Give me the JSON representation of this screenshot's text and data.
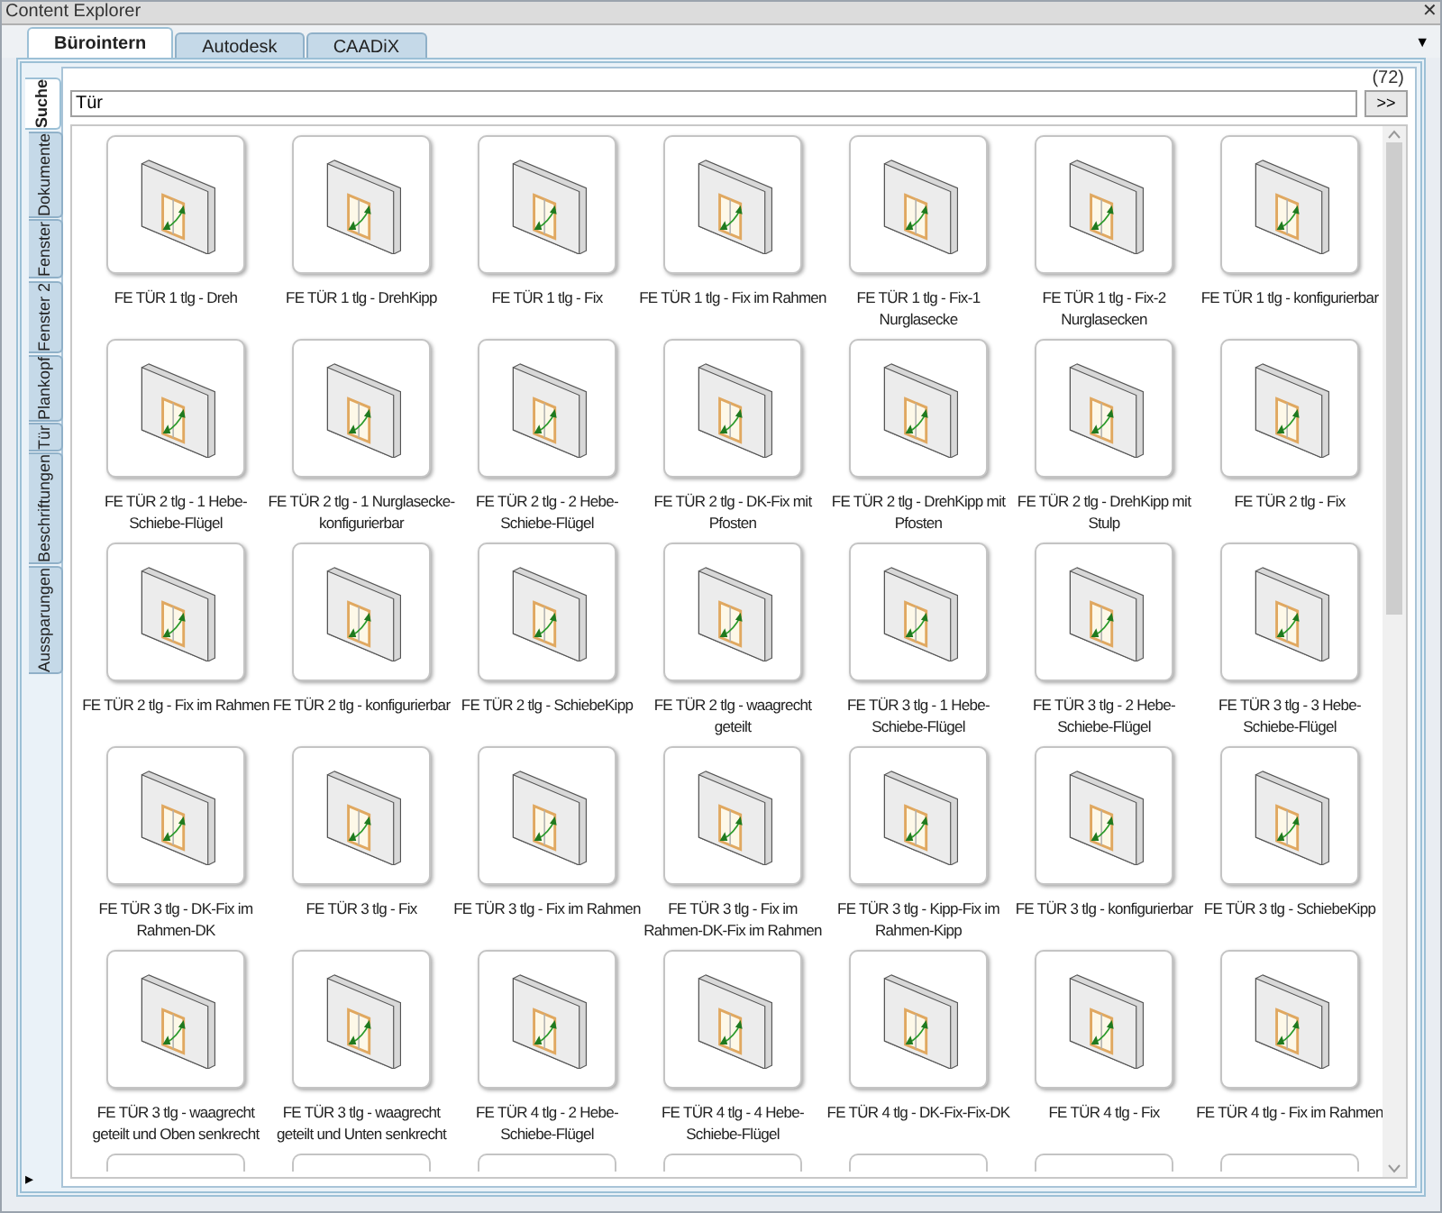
{
  "window": {
    "title": "Content Explorer",
    "close": "✕"
  },
  "tabs": [
    {
      "label": "Bürointern",
      "selected": true
    },
    {
      "label": "Autodesk",
      "selected": false
    },
    {
      "label": "CAADiX",
      "selected": false
    }
  ],
  "tab_menu": "▼",
  "side_tabs": [
    {
      "label": "Suche",
      "selected": true
    },
    {
      "label": "Dokumente",
      "selected": false
    },
    {
      "label": "Fenster",
      "selected": false
    },
    {
      "label": "Fenster 2",
      "selected": false
    },
    {
      "label": "Plankopf",
      "selected": false
    },
    {
      "label": "Tür",
      "selected": false
    },
    {
      "label": "Beschriftungen",
      "selected": false
    },
    {
      "label": "Aussparungen",
      "selected": false
    }
  ],
  "side_expand": "▸",
  "search": {
    "count": "(72)",
    "value": "Tür",
    "button": ">>"
  },
  "items": [
    {
      "kind": "tile",
      "label": "FE TÜR 1 tlg - Dreh"
    },
    {
      "kind": "tile",
      "label": "FE TÜR 1 tlg - DrehKipp"
    },
    {
      "kind": "tile",
      "label": "FE TÜR 1 tlg - Fix"
    },
    {
      "kind": "tile",
      "label": "FE TÜR 1 tlg - Fix im Rahmen"
    },
    {
      "kind": "tile",
      "label": "FE TÜR 1 tlg - Fix-1 Nurglasecke"
    },
    {
      "kind": "tile",
      "label": "FE TÜR 1 tlg - Fix-2 Nurglasecken"
    },
    {
      "kind": "tile",
      "label": "FE TÜR 1 tlg - konfigurierbar"
    },
    {
      "kind": "tile",
      "label": "FE TÜR 2 tlg - 1 Hebe-Schiebe-Flügel"
    },
    {
      "kind": "tile",
      "label": "FE TÜR 2 tlg - 1 Nurglasecke-konfigurierbar"
    },
    {
      "kind": "tile",
      "label": "FE TÜR 2 tlg - 2 Hebe-Schiebe-Flügel"
    },
    {
      "kind": "tile",
      "label": "FE TÜR 2 tlg - DK-Fix mit Pfosten"
    },
    {
      "kind": "tile",
      "label": "FE TÜR 2 tlg - DrehKipp mit Pfosten"
    },
    {
      "kind": "tile",
      "label": "FE TÜR 2 tlg - DrehKipp mit Stulp"
    },
    {
      "kind": "tile",
      "label": "FE TÜR 2 tlg - Fix"
    },
    {
      "kind": "tile",
      "label": "FE TÜR 2 tlg - Fix im Rahmen"
    },
    {
      "kind": "tile",
      "label": "FE TÜR 2 tlg - konfigurierbar"
    },
    {
      "kind": "tile",
      "label": "FE TÜR 2 tlg - SchiebeKipp"
    },
    {
      "kind": "tile",
      "label": "FE TÜR 2 tlg - waagrecht geteilt"
    },
    {
      "kind": "tile",
      "label": "FE TÜR 3 tlg - 1 Hebe-Schiebe-Flügel"
    },
    {
      "kind": "tile",
      "label": "FE TÜR 3 tlg - 2 Hebe-Schiebe-Flügel"
    },
    {
      "kind": "tile",
      "label": "FE TÜR 3 tlg - 3 Hebe-Schiebe-Flügel"
    },
    {
      "kind": "tile",
      "label": "FE TÜR 3 tlg - DK-Fix im Rahmen-DK"
    },
    {
      "kind": "tile",
      "label": "FE TÜR 3 tlg - Fix"
    },
    {
      "kind": "tile",
      "label": "FE TÜR 3 tlg - Fix im Rahmen"
    },
    {
      "kind": "tile",
      "label": "FE TÜR 3 tlg - Fix im Rahmen-DK-Fix im Rahmen"
    },
    {
      "kind": "tile",
      "label": "FE TÜR 3 tlg - Kipp-Fix im Rahmen-Kipp"
    },
    {
      "kind": "tile",
      "label": "FE TÜR 3 tlg - konfigurierbar"
    },
    {
      "kind": "tile",
      "label": "FE TÜR 3 tlg - SchiebeKipp"
    },
    {
      "kind": "tile",
      "label": "FE TÜR 3 tlg - waagrecht geteilt und Oben senkrecht"
    },
    {
      "kind": "tile",
      "label": "FE TÜR 3 tlg - waagrecht geteilt und Unten senkrecht"
    },
    {
      "kind": "tile",
      "label": "FE TÜR 4 tlg - 2 Hebe-Schiebe-Flügel"
    },
    {
      "kind": "tile",
      "label": "FE TÜR 4 tlg - 4 Hebe-Schiebe-Flügel"
    },
    {
      "kind": "tile",
      "label": "FE TÜR 4 tlg - DK-Fix-Fix-DK"
    },
    {
      "kind": "tile",
      "label": "FE TÜR 4 tlg - Fix"
    },
    {
      "kind": "tile",
      "label": "FE TÜR 4 tlg - Fix im Rahmen"
    },
    {
      "kind": "clipped"
    },
    {
      "kind": "clipped"
    },
    {
      "kind": "clipped"
    },
    {
      "kind": "clipped"
    },
    {
      "kind": "clipped"
    },
    {
      "kind": "clipped"
    },
    {
      "kind": "clipped"
    }
  ]
}
